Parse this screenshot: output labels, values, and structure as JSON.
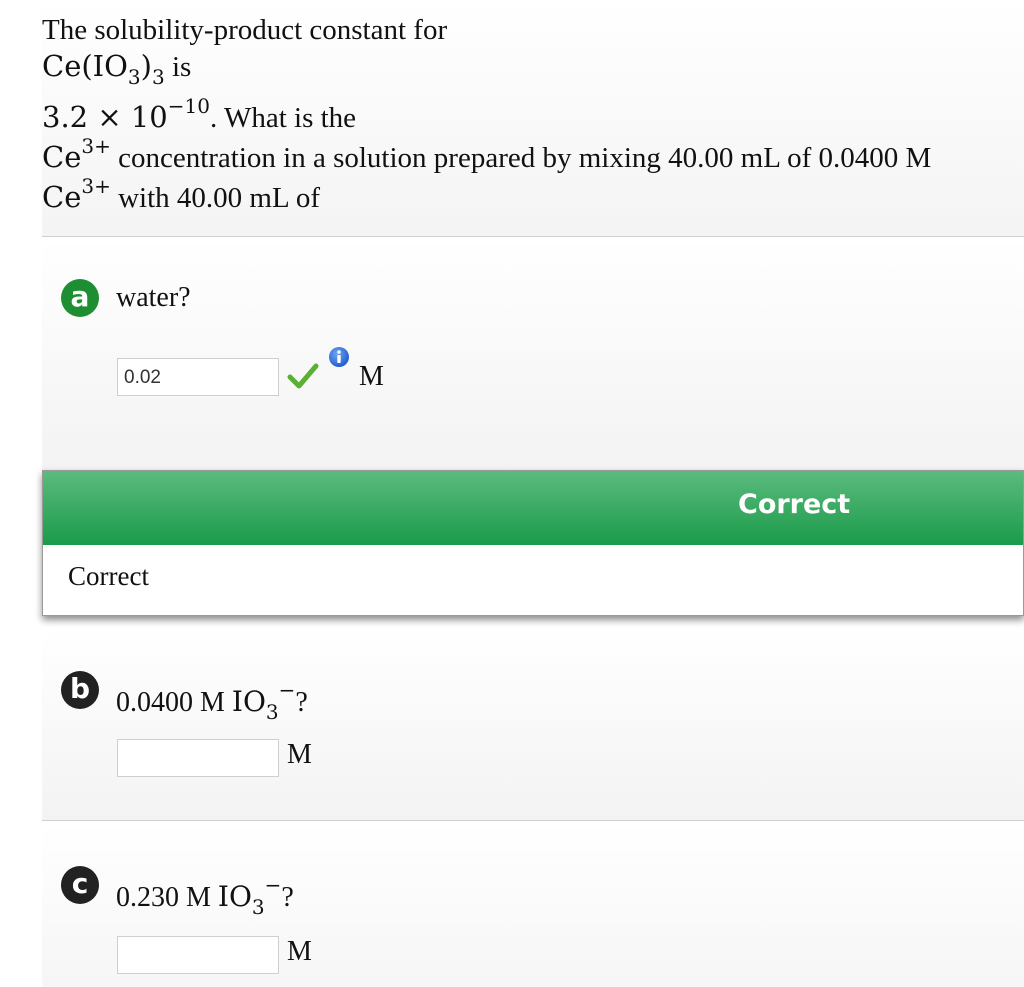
{
  "stem": {
    "line1": "The solubility-product constant for",
    "compound_base": "Ce(IO",
    "compound_sub": "3",
    "compound_close": ")",
    "compound_sub2": "3",
    "is_text": " is",
    "ksp_coeff": "3.2 × 10",
    "ksp_exp": "−10",
    "what_text": ". What is the",
    "ion": "Ce",
    "ion_charge": "3+",
    "line4_rest": " concentration in a solution prepared by mixing 40.00 mL of 0.0400 M",
    "line5_rest": " with 40.00 mL of"
  },
  "parts": [
    {
      "letter": "a",
      "question": "water?",
      "answer": "0.02",
      "unit": "M",
      "status": "correct"
    },
    {
      "letter": "b",
      "question_prefix": "0.0400 M ",
      "question_ion": "IO",
      "question_sub": "3",
      "question_sup": "−",
      "question_suffix": "?",
      "answer": "",
      "unit": "M"
    },
    {
      "letter": "c",
      "question_prefix": "0.230 M ",
      "question_ion": "IO",
      "question_sub": "3",
      "question_sup": "−",
      "question_suffix": "?",
      "answer": "",
      "unit": "M"
    }
  ],
  "feedback": {
    "title": "Correct",
    "body": "Correct"
  },
  "colors": {
    "correct_green": "#1e8e32",
    "check_green": "#5ab034",
    "info_blue": "#2b6fd6"
  },
  "icons": [
    "check-icon",
    "info-icon"
  ]
}
